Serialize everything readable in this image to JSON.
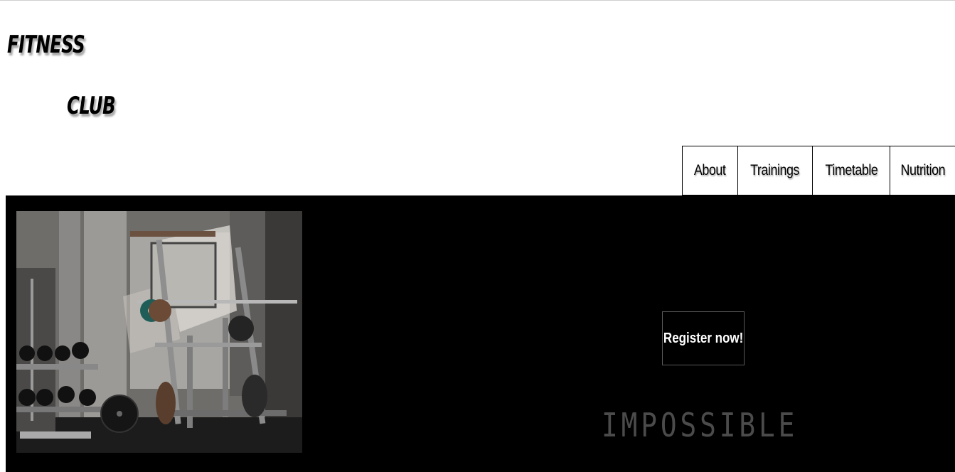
{
  "logo": {
    "line1": "FITNESS",
    "line2": "CLUB"
  },
  "nav": {
    "items": [
      {
        "label": "About"
      },
      {
        "label": "Trainings"
      },
      {
        "label": "Timetable"
      },
      {
        "label": "Nutrition"
      }
    ]
  },
  "hero": {
    "image": "gym-equipment-photo",
    "register_label": "Register now!",
    "tagline": "IMPOSSIBLE"
  },
  "colors": {
    "hero_background": "#000000",
    "tagline": "#4b4b4b",
    "button_border": "#5a5a5a"
  }
}
